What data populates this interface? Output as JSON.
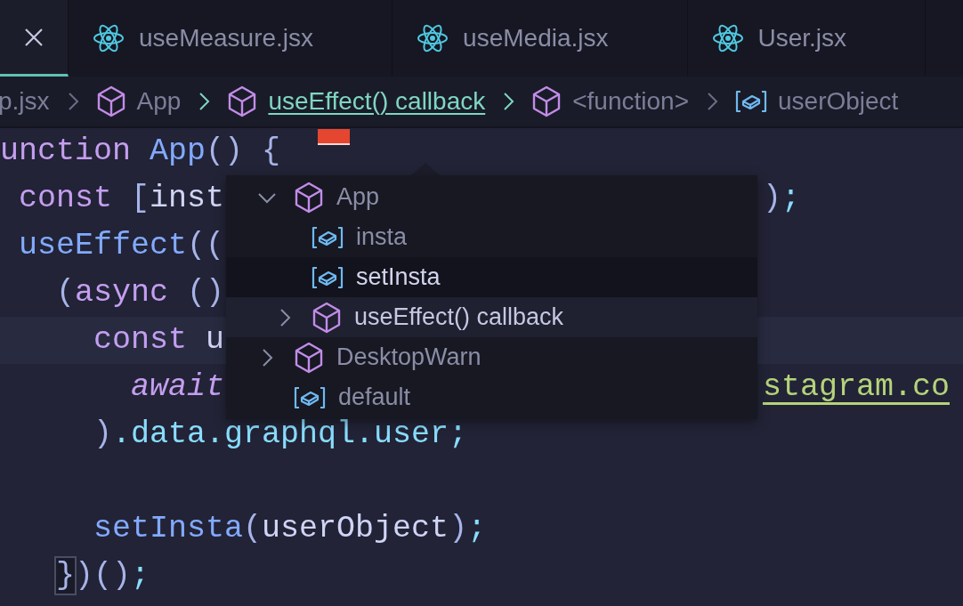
{
  "tabs": [
    {
      "kind": "close-only",
      "selected": true
    },
    {
      "kind": "file",
      "label": "useMeasure.jsx",
      "selected": false
    },
    {
      "kind": "file",
      "label": "useMedia.jsx",
      "selected": false
    },
    {
      "kind": "file",
      "label": "User.jsx",
      "selected": false
    }
  ],
  "breadcrumbs": [
    {
      "kind": "file",
      "label": "p.jsx",
      "selected": false
    },
    {
      "kind": "module",
      "label": "App",
      "selected": false
    },
    {
      "kind": "module",
      "label": "useEffect() callback",
      "selected": true
    },
    {
      "kind": "module",
      "label": "<function>",
      "selected": false
    },
    {
      "kind": "variable",
      "label": "userObject",
      "selected": false
    }
  ],
  "code_lines": [
    {
      "kind": "code",
      "error": true,
      "left": [
        {
          "kind": "keyword",
          "text": "unction"
        },
        {
          "kind": "function",
          "text": " App"
        },
        {
          "kind": "punct",
          "text": "() {"
        }
      ]
    },
    {
      "kind": "code",
      "left": [
        {
          "kind": "keyword",
          "text": " const"
        },
        {
          "kind": "punct",
          "text": " ["
        },
        {
          "kind": "variable",
          "text": "inst"
        }
      ],
      "right": [
        {
          "kind": "punct",
          "text": ")"
        },
        {
          "kind": "property",
          "text": ";"
        }
      ]
    },
    {
      "kind": "code",
      "left": [
        {
          "kind": "function",
          "text": " useEffect"
        },
        {
          "kind": "punct",
          "text": "(("
        }
      ]
    },
    {
      "kind": "code",
      "left": [
        {
          "kind": "punct",
          "text": "   ("
        },
        {
          "kind": "keyword",
          "text": "async"
        },
        {
          "kind": "punct",
          "text": " ()"
        }
      ]
    },
    {
      "kind": "code",
      "current": true,
      "left": [
        {
          "kind": "keyword",
          "text": "     const"
        },
        {
          "kind": "variable",
          "text": " u"
        }
      ]
    },
    {
      "kind": "code",
      "left": [
        {
          "kind": "keyword-italic",
          "text": "       await"
        }
      ],
      "right": [
        {
          "kind": "string",
          "text": "stagram.co"
        }
      ]
    },
    {
      "kind": "code",
      "left": [
        {
          "kind": "punct",
          "text": "     )"
        },
        {
          "kind": "property",
          "text": ".data.graphql.user;"
        }
      ]
    },
    {
      "kind": "blank"
    },
    {
      "kind": "code",
      "left": [
        {
          "kind": "function",
          "text": "     setInsta"
        },
        {
          "kind": "punct",
          "text": "("
        },
        {
          "kind": "variable",
          "text": "userObject"
        },
        {
          "kind": "punct",
          "text": ")"
        },
        {
          "kind": "property",
          "text": ";"
        }
      ]
    },
    {
      "kind": "code",
      "left": [
        {
          "kind": "punct",
          "text": "   }",
          "matched": true
        },
        {
          "kind": "punct",
          "text": ")()"
        },
        {
          "kind": "property",
          "text": ";"
        }
      ]
    }
  ],
  "outline": [
    {
      "kind": "module",
      "label": "App",
      "expanded": true,
      "selected": false,
      "hovered": false,
      "children": [
        {
          "kind": "variable",
          "label": "insta",
          "selected": false,
          "hovered": false
        },
        {
          "kind": "variable",
          "label": "setInsta",
          "selected": false,
          "hovered": true
        },
        {
          "kind": "module",
          "label": "useEffect() callback",
          "expanded": false,
          "selected": true,
          "hovered": false
        }
      ]
    },
    {
      "kind": "module",
      "label": "DesktopWarn",
      "expanded": false,
      "selected": false,
      "hovered": false
    },
    {
      "kind": "variable",
      "label": "default",
      "selected": false,
      "hovered": false
    }
  ]
}
